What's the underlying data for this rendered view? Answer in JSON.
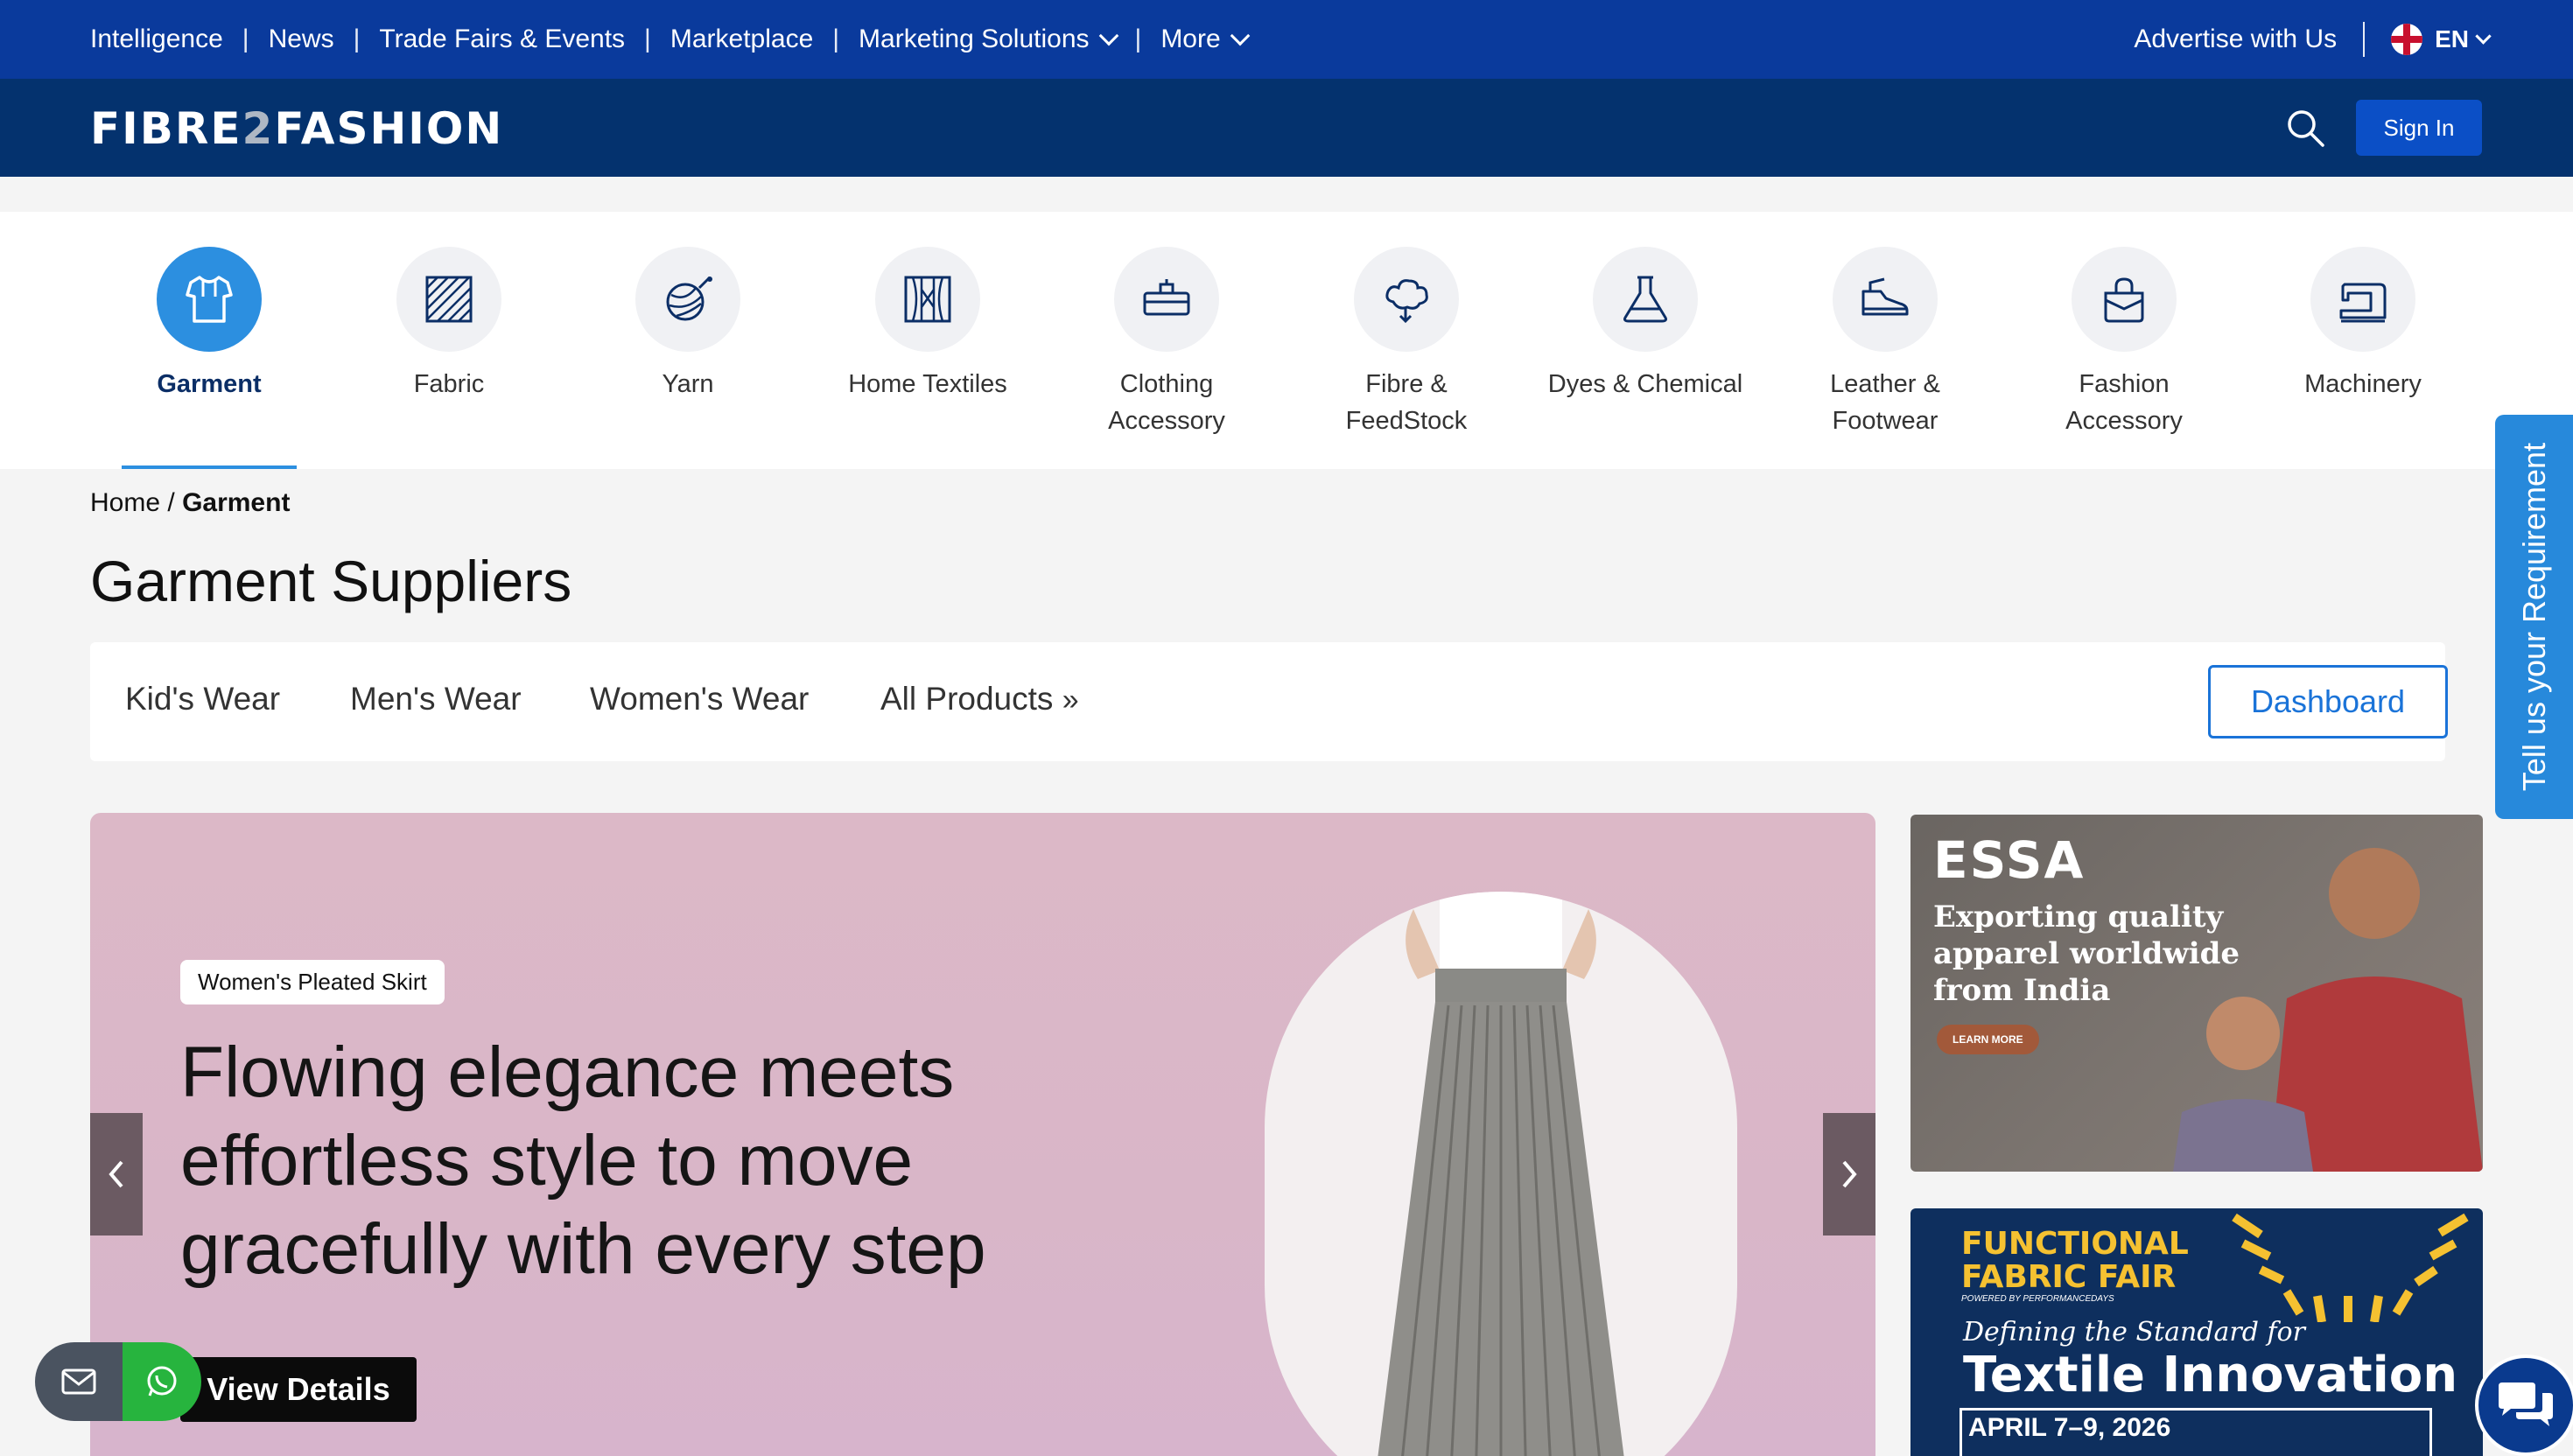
{
  "topnav": {
    "items": [
      "Intelligence",
      "News",
      "Trade Fairs & Events",
      "Marketplace",
      "Marketing Solutions",
      "More"
    ],
    "advertise": "Advertise with Us",
    "language": "EN"
  },
  "header": {
    "logo_part1": "FIBRE",
    "logo_part2": "2",
    "logo_part3": "FASHION",
    "signin_label": "Sign In"
  },
  "categories": [
    {
      "label": "Garment",
      "icon": "garment-icon",
      "active": true
    },
    {
      "label": "Fabric",
      "icon": "fabric-icon"
    },
    {
      "label": "Yarn",
      "icon": "yarn-icon"
    },
    {
      "label": "Home Textiles",
      "icon": "home-textiles-icon"
    },
    {
      "label": "Clothing Accessory",
      "icon": "clothing-accessory-icon"
    },
    {
      "label": "Fibre & FeedStock",
      "icon": "fibre-icon"
    },
    {
      "label": "Dyes & Chemical",
      "icon": "flask-icon"
    },
    {
      "label": "Leather & Footwear",
      "icon": "shoe-icon"
    },
    {
      "label": "Fashion Accessory",
      "icon": "bag-icon"
    },
    {
      "label": "Machinery",
      "icon": "sewing-machine-icon"
    }
  ],
  "breadcrumb": {
    "home": "Home",
    "sep": "/",
    "current": "Garment"
  },
  "page_title": "Garment Suppliers",
  "subnav": {
    "tabs": [
      "Kid's Wear",
      "Men's Wear",
      "Women's Wear",
      "All Products"
    ],
    "dashboard_label": "Dashboard"
  },
  "hero": {
    "badge": "Women's Pleated Skirt",
    "headline": "Flowing elegance meets effortless style to move gracefully with every step",
    "cta": "View Details"
  },
  "ad_essa": {
    "brand": "ESSA",
    "tagline_1": "Exporting quality",
    "tagline_2": "apparel worldwide",
    "tagline_3": "from India",
    "cta": "LEARN MORE"
  },
  "ad_fair": {
    "title_1": "FUNCTIONAL",
    "title_2": "FABRIC FAIR",
    "powered": "POWERED BY PERFORMANCEDAYS",
    "subtitle": "Defining the Standard for",
    "headline": "Textile Innovation",
    "dates": "APRIL 7–9, 2026"
  },
  "side_tab": "Tell us your Requirement",
  "colors": {
    "top_bar": "#0a3a9c",
    "header": "#04326e",
    "accent": "#2c8fe0",
    "hero_bg": "#dcb8c7"
  }
}
